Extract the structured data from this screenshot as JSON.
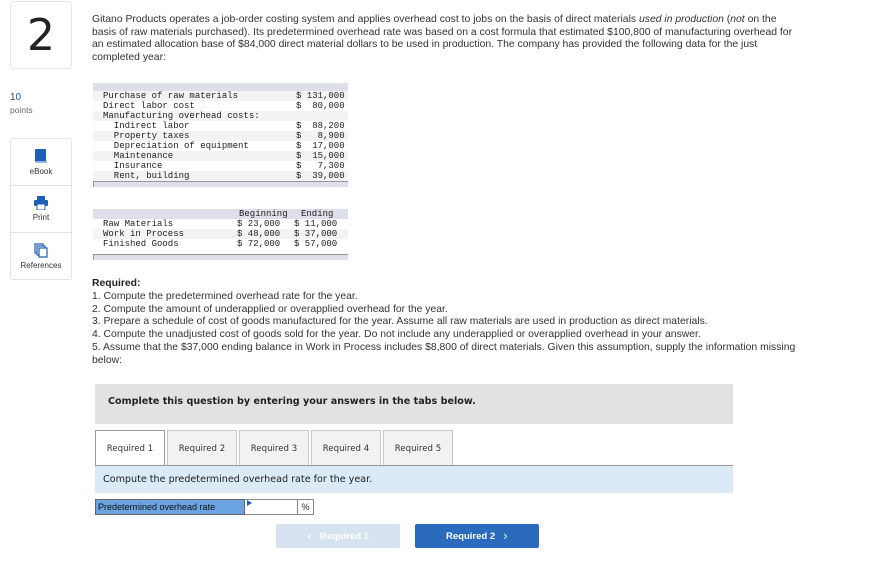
{
  "question": {
    "number": "2",
    "points_value": "10",
    "points_label": "points",
    "intro": [
      {
        "t": "Gitano Products operates a job-order costing system and applies overhead cost to jobs on the basis of direct materials ",
        "i": false
      },
      {
        "t": "used in production",
        "i": true
      },
      {
        "t": " (",
        "i": false
      },
      {
        "t": "not",
        "i": true
      },
      {
        "t": " on the basis of raw materials purchased). Its predetermined overhead rate was based on a cost formula that estimated $100,800 of manufacturing overhead for an estimated allocation base of $84,000 direct material dollars to be used in production. The company has provided the following data for the just completed year:",
        "i": false
      }
    ]
  },
  "tools": [
    {
      "name": "ebook",
      "label": "eBook"
    },
    {
      "name": "print",
      "label": "Print"
    },
    {
      "name": "references",
      "label": "References"
    }
  ],
  "costs_table": {
    "rows": [
      {
        "label": "Purchase of raw materials",
        "amount": "$ 131,000"
      },
      {
        "label": "Direct labor cost",
        "amount": "$  80,000"
      },
      {
        "label": "Manufacturing overhead costs:",
        "amount": ""
      },
      {
        "label": "  Indirect labor",
        "amount": "$  88,200"
      },
      {
        "label": "  Property taxes",
        "amount": "$   8,900"
      },
      {
        "label": "  Depreciation of equipment",
        "amount": "$  17,000"
      },
      {
        "label": "  Maintenance",
        "amount": "$  15,000"
      },
      {
        "label": "  Insurance",
        "amount": "$   7,300"
      },
      {
        "label": "  Rent, building",
        "amount": "$  39,000"
      }
    ]
  },
  "inventory_table": {
    "headers": [
      "Beginning",
      "Ending"
    ],
    "rows": [
      {
        "label": "Raw Materials",
        "beginning": "$ 23,000",
        "ending": "$ 11,000"
      },
      {
        "label": "Work in Process",
        "beginning": "$ 48,000",
        "ending": "$ 37,000"
      },
      {
        "label": "Finished Goods",
        "beginning": "$ 72,000",
        "ending": "$ 57,000"
      }
    ]
  },
  "required": {
    "heading": "Required:",
    "items": [
      "1. Compute the predetermined overhead rate for the year.",
      "2. Compute the amount of underapplied or overapplied overhead for the year.",
      "3. Prepare a schedule of cost of goods manufactured for the year. Assume all raw materials are used in production as direct materials.",
      "4. Compute the unadjusted cost of goods sold for the year. Do not include any underapplied or overapplied overhead in your answer.",
      "5. Assume that the $37,000 ending balance in Work in Process includes $8,800 of direct materials. Given this assumption, supply the information missing below:"
    ]
  },
  "instructions": "Complete this question by entering your answers in the tabs below.",
  "tabs": [
    {
      "label": "Required 1",
      "active": true
    },
    {
      "label": "Required 2",
      "active": false
    },
    {
      "label": "Required 3",
      "active": false
    },
    {
      "label": "Required 4",
      "active": false
    },
    {
      "label": "Required 5",
      "active": false
    }
  ],
  "active_panel": {
    "prompt": "Compute the predetermined overhead rate for the year.",
    "field_label": "Predetermined overhead rate",
    "field_value": "",
    "unit": "%"
  },
  "nav": {
    "prev_label": "Required 1",
    "next_label": "Required 2",
    "prev_enabled": false
  },
  "colors": {
    "accent": "#2b6bbd",
    "disabled_button": "#d6e2f0",
    "field_label_bg": "#6aa3e0",
    "prompt_bg": "#dbeaf7"
  }
}
